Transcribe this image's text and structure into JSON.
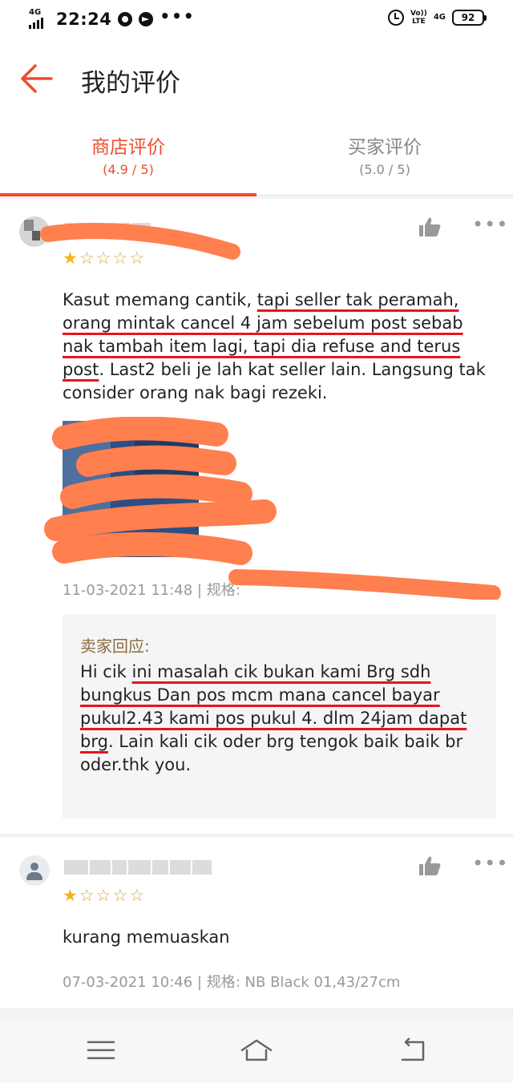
{
  "status_bar": {
    "network_label": "4G",
    "time": "22:24",
    "dots": "•••",
    "volte_line1": "Vo))",
    "volte_line2": "LTE",
    "network_right": "4G",
    "battery": "92"
  },
  "header": {
    "title": "我的评价"
  },
  "tabs": [
    {
      "label": "商店评价",
      "score": "(4.9 / 5)"
    },
    {
      "label": "买家评价",
      "score": "(5.0 / 5)"
    }
  ],
  "reviews": [
    {
      "stars_filled": 1,
      "stars_total": 5,
      "text_parts": [
        "Kasut memang cantik, ",
        "tapi seller tak peramah, orang mintak cancel 4 jam sebelum post sebab nak tambah item lagi, tapi dia refuse and terus post",
        ". Last2 beli je lah kat seller lain. Langsung tak consider orang nak bagi rezeki."
      ],
      "meta_date": "11-03-2021 11:48",
      "meta_spec_label": "规格:",
      "meta_spec_value": "",
      "seller_reply": {
        "title": "卖家回应:",
        "text_parts": [
          "Hi cik ",
          "ini masalah cik bukan kami Brg sdh bungkus Dan pos mcm mana cancel bayar pukul2.43 kami pos pukul 4. dlm 24jam dapat brg",
          ". Lain kali cik oder brg tengok baik baik br oder.thk you."
        ]
      }
    },
    {
      "stars_filled": 1,
      "stars_total": 5,
      "text": "kurang memuaskan",
      "meta_date": "07-03-2021 10:46",
      "meta_spec_label": "规格:",
      "meta_spec_value": "NB Black 01,43/27cm"
    }
  ],
  "icons": {
    "back": "back-arrow-icon",
    "like": "thumbs-up-icon",
    "more": "more-dots-icon",
    "nav_menu": "menu-icon",
    "nav_home": "home-icon",
    "nav_back": "back-icon"
  },
  "colors": {
    "accent": "#ee4d2d",
    "star": "#f6b319",
    "redaction": "#ff7f4f",
    "highlight_underline": "#e8141e",
    "reply_title": "#8b6b3e"
  }
}
